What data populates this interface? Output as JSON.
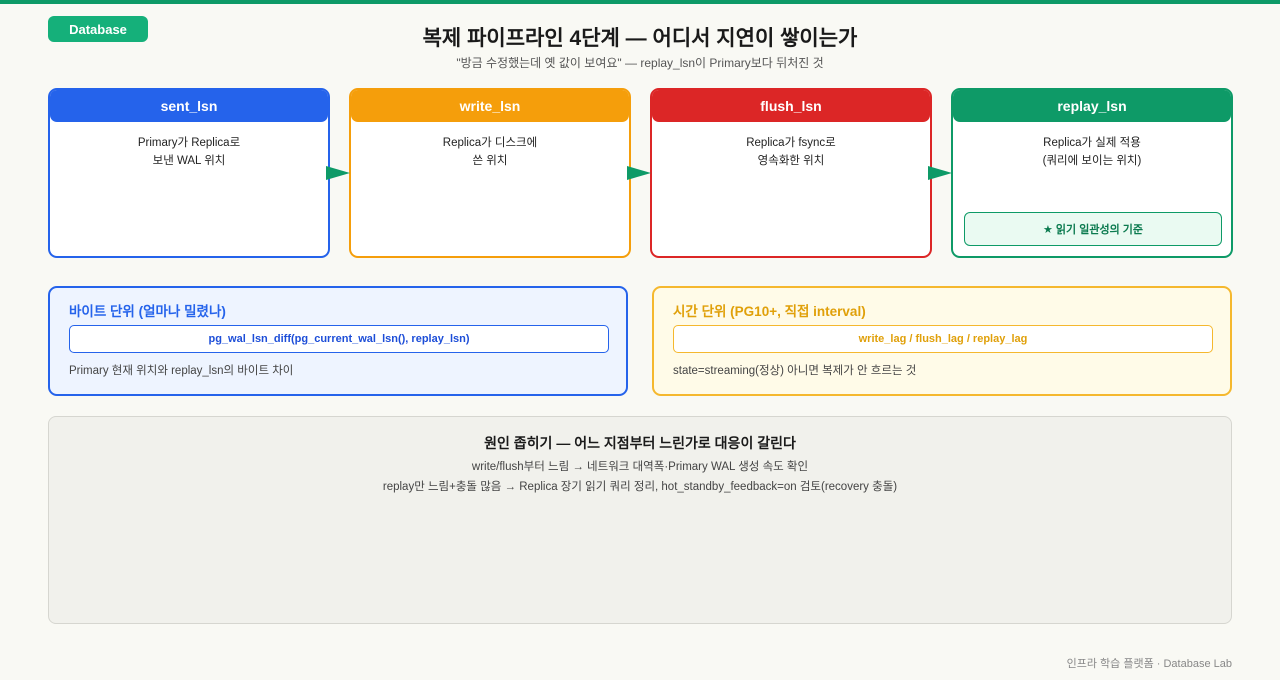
{
  "badge": "Database",
  "title": "복제 파이프라인 4단계 — 어디서 지연이 쌓이는가",
  "subtitle": "\"방금 수정했는데 옛 값이 보여요\" — replay_lsn이 Primary보다 뒤처진 것",
  "colors": {
    "green": "#0e9a67",
    "blue": "#2563eb",
    "orange": "#f59e0b",
    "red": "#dc2626"
  },
  "stages": [
    {
      "label": "sent_lsn",
      "desc": "Primary가 Replica로\n보낸 WAL 위치",
      "color": "#2563eb"
    },
    {
      "label": "write_lsn",
      "desc": "Replica가 디스크에\n쓴 위치",
      "color": "#f59e0b"
    },
    {
      "label": "flush_lsn",
      "desc": "Replica가 fsync로\n영속화한 위치",
      "color": "#dc2626"
    },
    {
      "label": "replay_lsn",
      "desc": "Replica가 실제 적용\n(쿼리에 보이는 위치)",
      "color": "#0e9a67",
      "note": "★ 읽기 일관성의 기준"
    }
  ],
  "byte_panel": {
    "title": "바이트 단위 (얼마나 밀렸나)",
    "code": "pg_wal_lsn_diff(pg_current_wal_lsn(), replay_lsn)",
    "desc": "Primary 현재 위치와 replay_lsn의 바이트 차이"
  },
  "time_panel": {
    "title": "시간 단위 (PG10+, 직접 interval)",
    "code": "write_lag / flush_lag / replay_lag",
    "desc": "state=streaming(정상) 아니면 복제가 안 흐르는 것"
  },
  "cause": {
    "title": "원인 좁히기 — 어느 지점부터 느린가로 대응이 갈린다",
    "line1": "write/flush부터 느림 → 네트워크 대역폭·Primary WAL 생성 속도 확인",
    "line2": "replay만 느림+충돌 많음 → Replica 장기 읽기 쿼리 정리, hot_standby_feedback=on 검토(recovery 충돌)"
  },
  "footer": "인프라 학습 플랫폼 · Database Lab"
}
